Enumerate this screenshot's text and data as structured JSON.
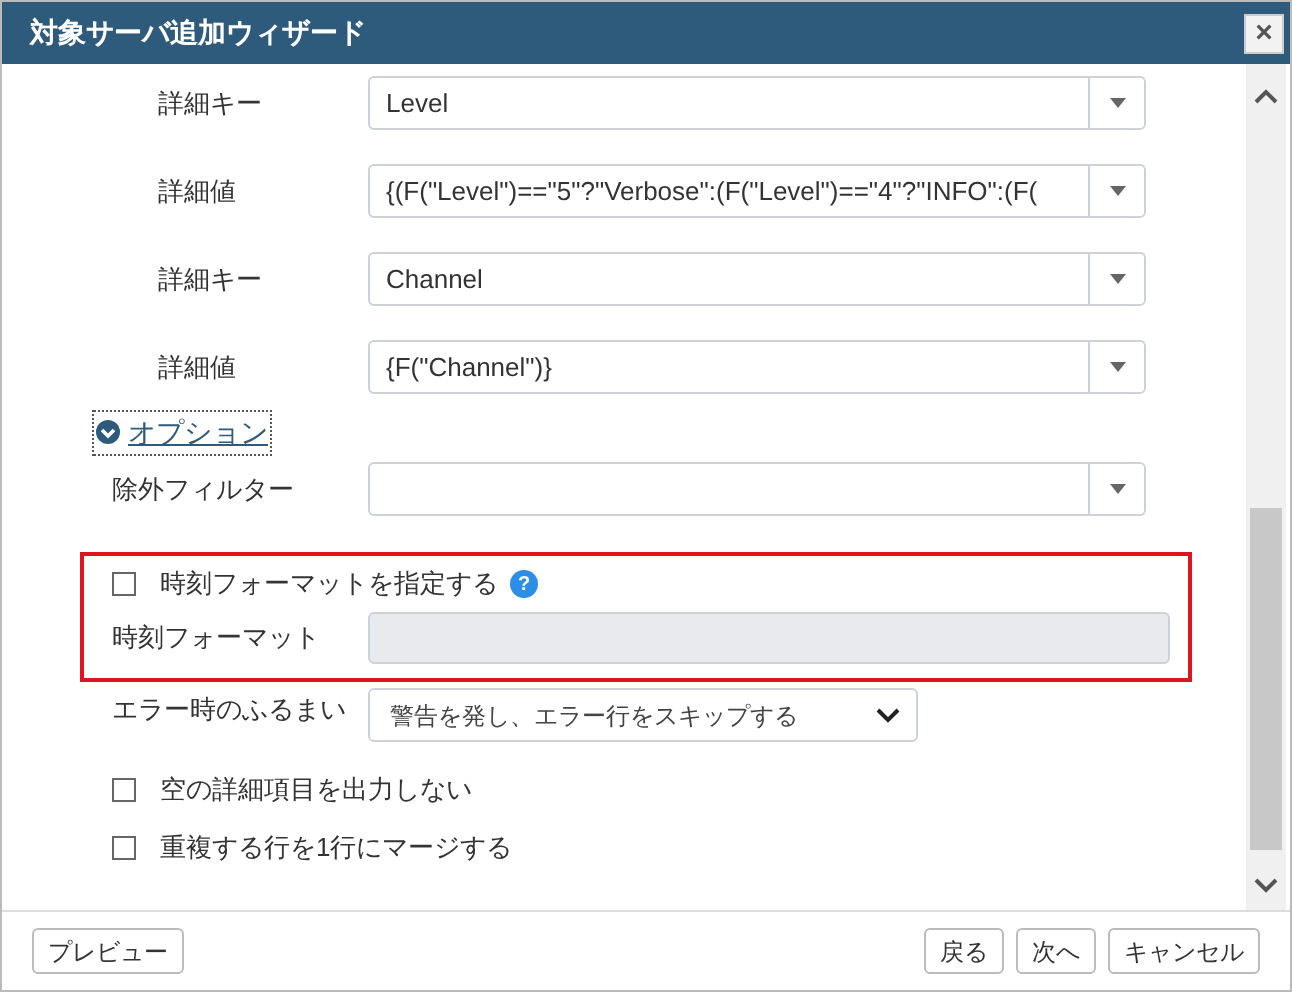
{
  "window": {
    "title": "対象サーバ追加ウィザード",
    "close": "×"
  },
  "detail_rows": [
    {
      "label": "詳細キー",
      "value": "Level"
    },
    {
      "label": "詳細値",
      "value": "{(F(\"Level\")==\"5\"?\"Verbose\":(F(\"Level\")==\"4\"?\"INFO\":(F("
    },
    {
      "label": "詳細キー",
      "value": "Channel"
    },
    {
      "label": "詳細値",
      "value": "{F(\"Channel\")}"
    }
  ],
  "options": {
    "label": "オプション",
    "expanded": true
  },
  "exclusion_filter": {
    "label": "除外フィルター"
  },
  "time_format_toggle": {
    "label": "時刻フォーマットを指定する",
    "checked": false,
    "help": "?"
  },
  "time_format": {
    "label": "時刻フォーマット",
    "disabled": true
  },
  "error_behavior": {
    "label": "エラー時のふるまい",
    "value": "警告を発し、エラー行をスキップする"
  },
  "checkboxes": [
    {
      "label": "空の詳細項目を出力しない",
      "checked": false
    },
    {
      "label": "重複する行を1行にマージする",
      "checked": false
    }
  ],
  "footer": {
    "preview": "プレビュー",
    "buttons": [
      "戻る",
      "次へ",
      "キャンセル"
    ]
  }
}
